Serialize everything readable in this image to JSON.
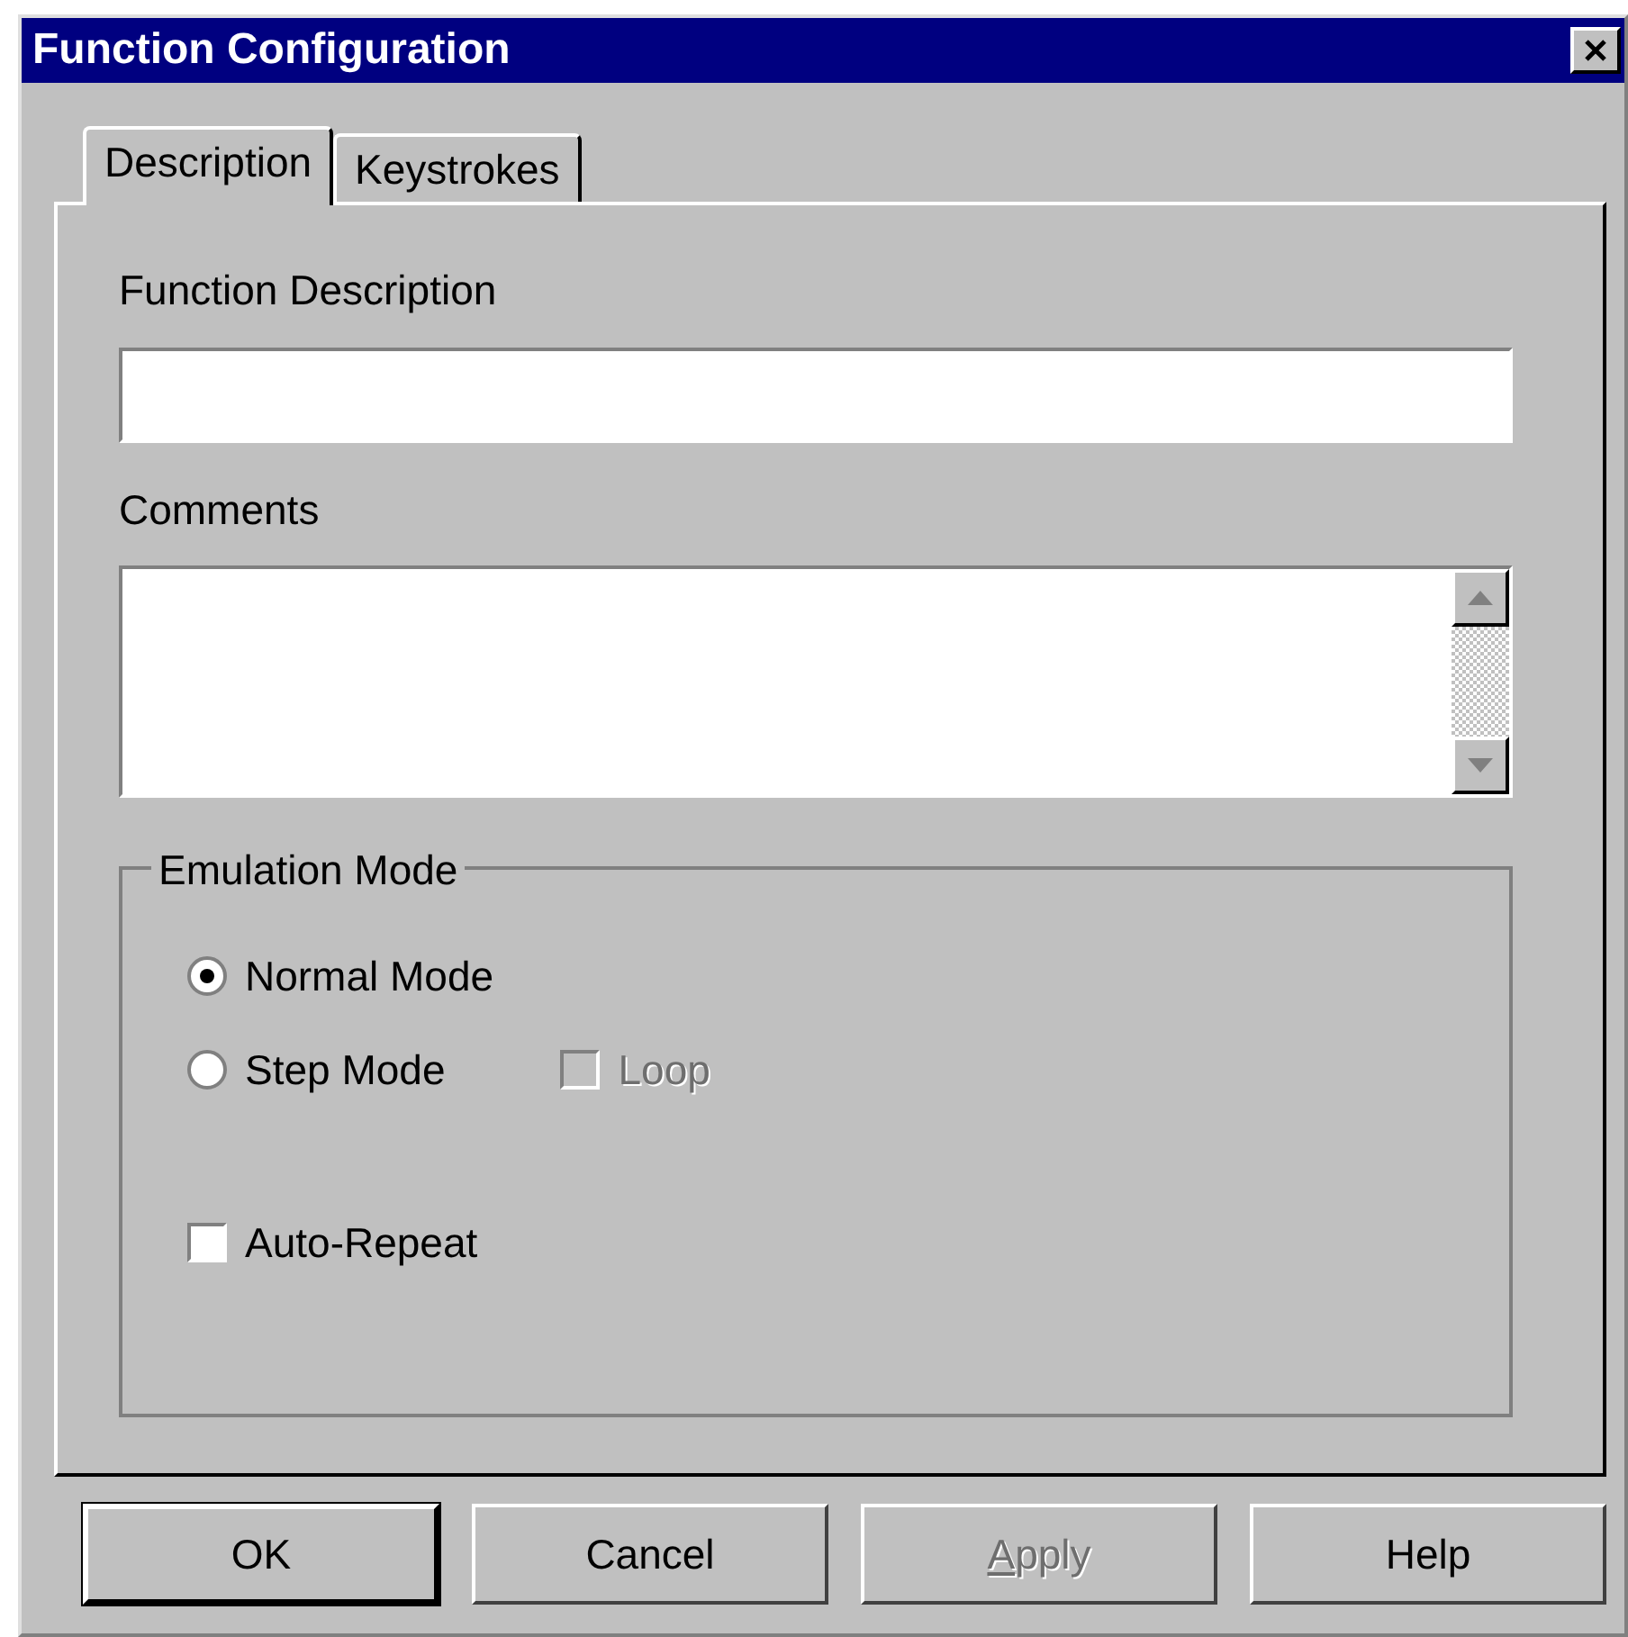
{
  "window": {
    "title": "Function Configuration"
  },
  "tabs": [
    {
      "label": "Description",
      "selected": true
    },
    {
      "label": "Keystrokes",
      "selected": false
    }
  ],
  "function_description": {
    "label": "Function Description"
  },
  "comments": {
    "label": "Comments"
  },
  "emulation_mode": {
    "title": "Emulation Mode",
    "rows": [
      {
        "items": [
          {
            "kind": "radio",
            "label": "Normal Mode",
            "selected": true,
            "disabled": false
          }
        ]
      },
      {
        "items": [
          {
            "kind": "radio",
            "label": "Step Mode",
            "selected": false,
            "disabled": false
          },
          {
            "kind": "checkbox",
            "label": "Loop",
            "checked": false,
            "disabled": true
          }
        ]
      },
      {
        "items": [
          {
            "kind": "checkbox",
            "label": "Auto-Repeat",
            "checked": false,
            "disabled": false
          }
        ]
      }
    ]
  },
  "buttons": [
    {
      "label": "OK",
      "default": true,
      "disabled": false,
      "mnemonic": false
    },
    {
      "label": "Cancel",
      "default": false,
      "disabled": false,
      "mnemonic": false
    },
    {
      "label": "Apply",
      "default": false,
      "disabled": true,
      "mnemonic": true
    },
    {
      "label": "Help",
      "default": false,
      "disabled": false,
      "mnemonic": false
    }
  ]
}
